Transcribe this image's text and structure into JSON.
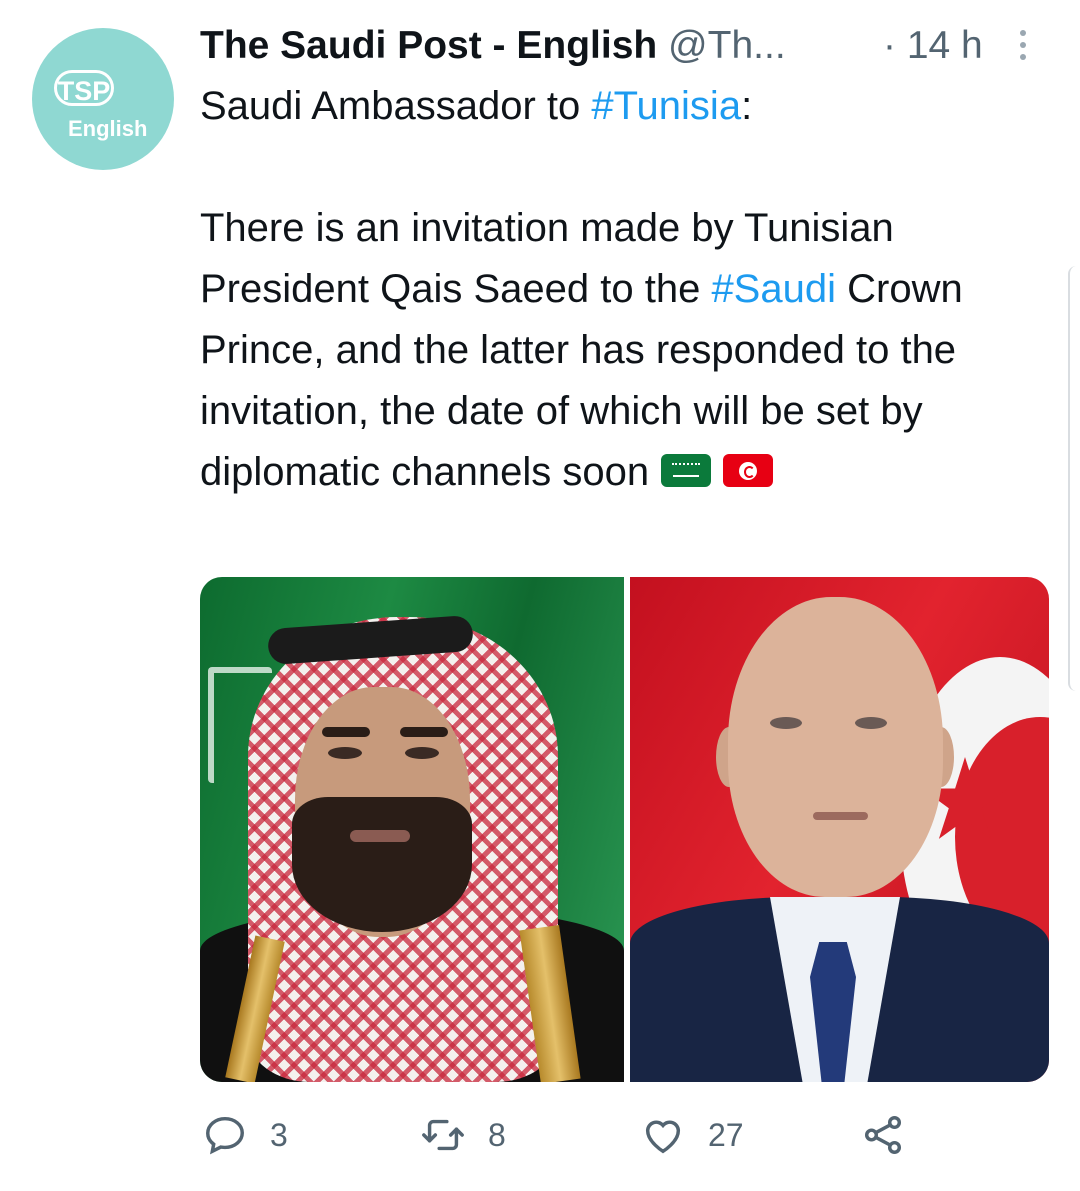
{
  "account": {
    "avatar_line1": "TSP",
    "avatar_line2": "English",
    "name": "The Saudi Post - English",
    "handle": "@Th...",
    "time": "· 14 h"
  },
  "tweet": {
    "line1_prefix": "Saudi Ambassador to ",
    "line1_hashtag": "#Tunisia",
    "line1_suffix": ":",
    "p2_a": "There is an invitation made by Tunisian President Qais Saeed to the ",
    "p2_hashtag": "#Saudi",
    "p2_b": " Crown Prince, and the latter has responded to the invitation, the date of which will be set by diplomatic channels soon",
    "flags": [
      "saudi-arabia-flag",
      "tunisia-flag"
    ]
  },
  "actions": {
    "reply_count": "3",
    "retweet_count": "8",
    "like_count": "27"
  },
  "colors": {
    "link": "#1d9bf0",
    "muted": "#536471",
    "avatar_bg": "#8fd8d2"
  }
}
